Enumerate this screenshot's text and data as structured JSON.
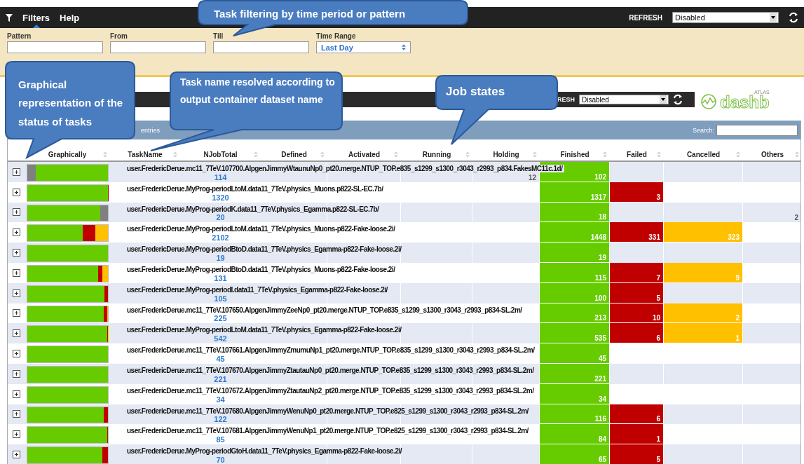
{
  "menu_bar": {
    "items": [
      {
        "label": "Filters",
        "selected": true
      },
      {
        "label": "Help",
        "selected": false
      }
    ],
    "refresh_label": "REFRESH",
    "refresh_value": "Disabled"
  },
  "filters": {
    "fields": [
      {
        "label": "Pattern",
        "kind": "text"
      },
      {
        "label": "From",
        "kind": "text"
      },
      {
        "label": "Till",
        "kind": "text"
      },
      {
        "label": "Time Range",
        "kind": "select",
        "value": "Last Day"
      }
    ]
  },
  "inner_bar": {
    "refresh_label": "RESH",
    "refresh_value": "Disabled",
    "logo_top": "ATLAS",
    "logo_main": "dashb"
  },
  "table_toolbar": {
    "entries_label": "entries",
    "search_label": "Search:"
  },
  "table": {
    "columns": [
      {
        "label": "Graphically",
        "kind": "graph"
      },
      {
        "label": "TaskName",
        "kind": "name"
      },
      {
        "label": "NJobTotal",
        "kind": "total"
      },
      {
        "label": "Defined",
        "kind": "defined"
      },
      {
        "label": "Activated",
        "kind": "activated"
      },
      {
        "label": "Running",
        "kind": "running"
      },
      {
        "label": "Holding",
        "kind": "holding"
      },
      {
        "label": "Finished",
        "kind": "finished"
      },
      {
        "label": "Failed",
        "kind": "failed"
      },
      {
        "label": "Cancelled",
        "kind": "cancelled"
      },
      {
        "label": "Others",
        "kind": "others"
      }
    ],
    "rows": [
      {
        "name": "user.FredericDerue.mc11_7TeV.107700.AlpgenJimmyWtaunuNp0_pt20.merge.NTUP_TOP.e835_s1299_s1300_r3043_r2993_p834.FakesMC11c.1d/",
        "total": "114",
        "counts": {
          "holding": "12",
          "finished": "102"
        }
      },
      {
        "name": "user.FredericDerue.MyProg-periodLtoM.data11_7TeV.physics_Muons.p822-SL-EC.7b/",
        "total": "1320",
        "counts": {
          "finished": "1317",
          "failed": "3"
        }
      },
      {
        "name": "user.FredericDerue.MyProg-periodK.data11_7TeV.physics_Egamma.p822-SL-EC.7b/",
        "total": "20",
        "counts": {
          "finished": "18",
          "others": "2"
        }
      },
      {
        "name": "user.FredericDerue.MyProg-periodLtoM.data11_7TeV.physics_Muons-p822-Fake-loose.2i/",
        "total": "2102",
        "counts": {
          "finished": "1448",
          "failed": "331",
          "cancelled": "323"
        }
      },
      {
        "name": "user.FredericDerue.MyProg-periodBtoD.data11_7TeV.physics_Egamma-p822-Fake-loose.2i/",
        "total": "19",
        "counts": {
          "finished": "19"
        }
      },
      {
        "name": "user.FredericDerue.MyProg-periodBtoD.data11_7TeV.physics_Muons-p822-Fake-loose.2i/",
        "total": "131",
        "counts": {
          "finished": "115",
          "failed": "7",
          "cancelled": "9"
        }
      },
      {
        "name": "user.FredericDerue.MyProg-periodI.data11_7TeV.physics_Egamma-p822-Fake-loose.2i/",
        "total": "105",
        "counts": {
          "finished": "100",
          "failed": "5"
        }
      },
      {
        "name": "user.FredericDerue.mc11_7TeV.107650.AlpgenJimmyZeeNp0_pt20.merge.NTUP_TOP.e835_s1299_s1300_r3043_r2993_p834-SL.2m/",
        "total": "225",
        "counts": {
          "finished": "213",
          "failed": "10",
          "cancelled": "2"
        }
      },
      {
        "name": "user.FredericDerue.MyProg-periodLtoM.data11_7TeV.physics_Egamma-p822-Fake-loose.2i/",
        "total": "542",
        "counts": {
          "finished": "535",
          "failed": "6",
          "cancelled": "1"
        }
      },
      {
        "name": "user.FredericDerue.mc11_7TeV.107661.AlpgenJimmyZmumuNp1_pt20.merge.NTUP_TOP.e835_s1299_s1300_r3043_r2993_p834-SL.2m/",
        "total": "45",
        "counts": {
          "finished": "45"
        }
      },
      {
        "name": "user.FredericDerue.mc11_7TeV.107670.AlpgenJimmyZtautauNp0_pt20.merge.NTUP_TOP.e835_s1299_s1300_r3043_r2993_p834-SL.2m/",
        "total": "221",
        "counts": {
          "finished": "221"
        }
      },
      {
        "name": "user.FredericDerue.mc11_7TeV.107672.AlpgenJimmyZtautauNp2_pt20.merge.NTUP_TOP.e835_s1299_s1300_r3043_r2993_p834-SL.2m/",
        "total": "34",
        "counts": {
          "finished": "34"
        }
      },
      {
        "name": "user.FredericDerue.mc11_7TeV.107680.AlpgenJimmyWenuNp0_pt20.merge.NTUP_TOP.e825_s1299_s1300_r3043_r2993_p834-SL.2m/",
        "total": "122",
        "counts": {
          "finished": "116",
          "failed": "6"
        }
      },
      {
        "name": "user.FredericDerue.mc11_7TeV.107681.AlpgenJimmyWenuNp1_pt20.merge.NTUP_TOP.e825_s1299_s1300_r3043_r2993_p834-SL.2m/",
        "total": "85",
        "counts": {
          "finished": "84",
          "failed": "1"
        }
      },
      {
        "name": "user.FredericDerue.MyProg-periodGtoH.data11_7TeV.physics_Egamma-p822-Fake-loose.2i/",
        "total": "70",
        "counts": {
          "finished": "65",
          "failed": "5"
        }
      }
    ]
  },
  "callouts": [
    {
      "text": "Task filtering by time period or pattern",
      "kind": "filter"
    },
    {
      "text": "Graphical representation of the status of tasks",
      "kind": "graph"
    },
    {
      "text": "Task name resolved according to output container dataset name",
      "kind": "name"
    },
    {
      "text": "Job states",
      "kind": "states"
    }
  ]
}
